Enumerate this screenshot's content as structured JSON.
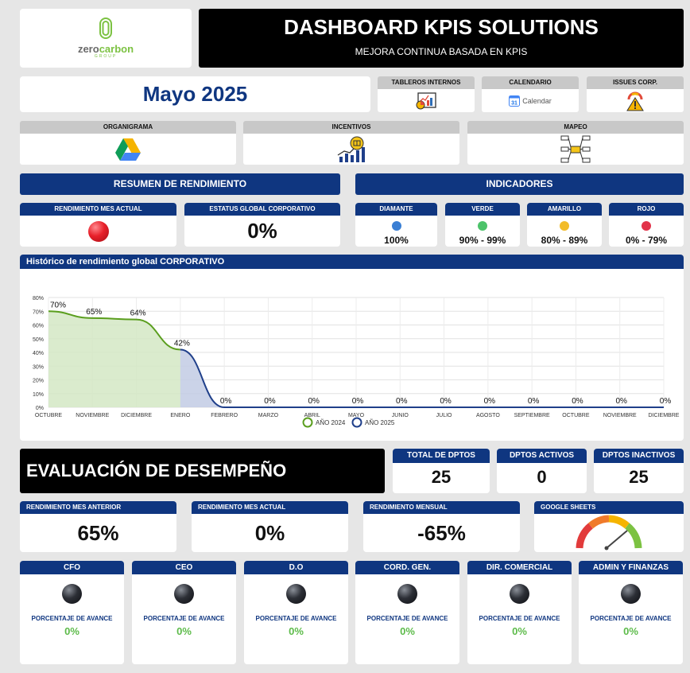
{
  "header": {
    "logo_text_a": "zero",
    "logo_text_b": "carbon",
    "logo_sub": "GROUP",
    "title": "DASHBOARD KPIS SOLUTIONS",
    "subtitle": "MEJORA CONTINUA BASADA EN KPIS"
  },
  "period": "Mayo 2025",
  "quick_links": [
    {
      "label": "TABLEROS INTERNOS",
      "icon": "chart-report-icon"
    },
    {
      "label": "CALENDARIO",
      "icon": "google-calendar-icon",
      "caption": "Calendar",
      "badge": "31"
    },
    {
      "label": "ISSUES CORP.",
      "icon": "warning-gauge-icon"
    },
    {
      "label": "ORGANIGRAMA",
      "icon": "google-drive-icon"
    },
    {
      "label": "INCENTIVOS",
      "icon": "growth-incentive-icon"
    },
    {
      "label": "MAPEO",
      "icon": "process-map-icon"
    }
  ],
  "summary": {
    "title": "RESUMEN DE RENDIMIENTO",
    "current_month_label": "RENDIMIENTO MES ACTUAL",
    "current_month_status_color": "#e8202a",
    "global_status_label": "ESTATUS GLOBAL CORPORATIVO",
    "global_status_value": "0%"
  },
  "indicators": {
    "title": "INDICADORES",
    "items": [
      {
        "label": "DIAMANTE",
        "range": "100%",
        "color": "#3a7fd4"
      },
      {
        "label": "VERDE",
        "range": "90% - 99%",
        "color": "#4cc36a"
      },
      {
        "label": "AMARILLO",
        "range": "80% - 89%",
        "color": "#f2bc2a"
      },
      {
        "label": "ROJO",
        "range": "0% - 79%",
        "color": "#e2334a"
      }
    ]
  },
  "chart_data": {
    "type": "area",
    "title": "Histórico de rendimiento global CORPORATIVO",
    "categories": [
      "OCTUBRE",
      "NOVIEMBRE",
      "DICIEMBRE",
      "ENERO",
      "FEBRERO",
      "MARZO",
      "ABRIL",
      "MAYO",
      "JUNIO",
      "JULIO",
      "AGOSTO",
      "SEPTIEMBRE",
      "OCTUBRE",
      "NOVIEMBRE",
      "DICIEMBRE"
    ],
    "y_ticks": [
      "0%",
      "10%",
      "20%",
      "30%",
      "40%",
      "50%",
      "60%",
      "70%",
      "80%"
    ],
    "ylim": [
      0,
      80
    ],
    "grid": true,
    "legend_position": "bottom",
    "series": [
      {
        "name": "AÑO 2024",
        "color": "#5a9e1e",
        "fill": "#d4e8c4",
        "start": 0,
        "values": [
          70,
          65,
          64,
          42
        ]
      },
      {
        "name": "AÑO 2025",
        "color": "#1f3f8a",
        "fill": "#c2cbe4",
        "start": 3,
        "values": [
          42,
          0,
          0,
          0,
          0,
          0,
          0,
          0,
          0,
          0,
          0,
          0
        ]
      }
    ],
    "point_labels": [
      "70%",
      "65%",
      "64%",
      "42%",
      "0%",
      "0%",
      "0%",
      "0%",
      "0%",
      "0%",
      "0%",
      "0%",
      "0%",
      "0%",
      "0%"
    ]
  },
  "evaluation": {
    "title": "EVALUACIÓN DE DESEMPEÑO",
    "totals": [
      {
        "label": "TOTAL DE DPTOS",
        "value": "25"
      },
      {
        "label": "DPTOS ACTIVOS",
        "value": "0"
      },
      {
        "label": "DPTOS INACTIVOS",
        "value": "25"
      }
    ],
    "metrics": [
      {
        "label": "RENDIMIENTO MES ANTERIOR",
        "value": "65%"
      },
      {
        "label": "RENDIMIENTO MES ACTUAL",
        "value": "0%"
      },
      {
        "label": "RENDIMIENTO MENSUAL",
        "value": "-65%"
      }
    ],
    "sheets_label": "GOOGLE SHEETS"
  },
  "departments": [
    {
      "name": "CFO",
      "progress_label": "PORCENTAJE DE AVANCE",
      "progress": "0%"
    },
    {
      "name": "CEO",
      "progress_label": "PORCENTAJE DE AVANCE",
      "progress": "0%"
    },
    {
      "name": "D.O",
      "progress_label": "PORCENTAJE DE AVANCE",
      "progress": "0%"
    },
    {
      "name": "CORD. GEN.",
      "progress_label": "PORCENTAJE DE AVANCE",
      "progress": "0%"
    },
    {
      "name": "DIR. COMERCIAL",
      "progress_label": "PORCENTAJE DE AVANCE",
      "progress": "0%"
    },
    {
      "name": "ADMIN Y FINANZAS",
      "progress_label": "PORCENTAJE DE AVANCE",
      "progress": "0%"
    }
  ]
}
